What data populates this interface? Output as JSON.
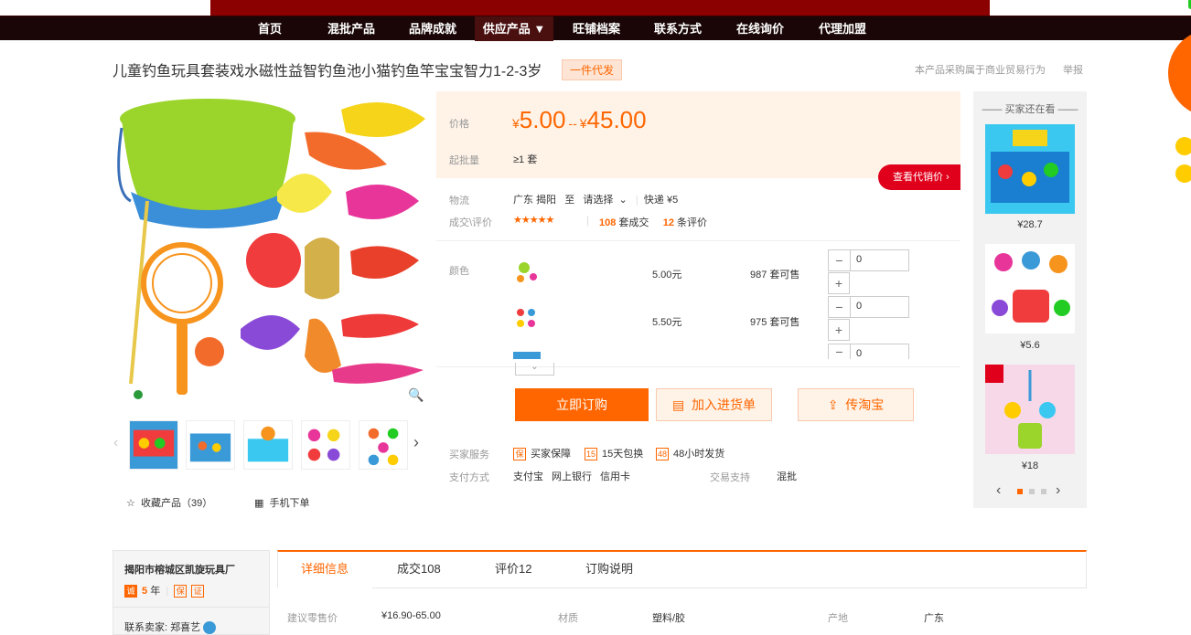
{
  "nav": {
    "items": [
      "首页",
      "混批产品",
      "品牌成就",
      "供应产品 ▼",
      "旺铺档案",
      "联系方式",
      "在线询价",
      "代理加盟"
    ]
  },
  "product": {
    "title": "儿童钓鱼玩具套装戏水磁性益智钓鱼池小猫钓鱼竿宝宝智力1-2-3岁",
    "tag": "一件代发",
    "note": "本产品采购属于商业贸易行为",
    "report": "举报"
  },
  "gallery": {
    "favorite": "收藏产品（39）",
    "mobile": "手机下单"
  },
  "price": {
    "label": "价格",
    "currency": "¥",
    "min": "5.00",
    "sep": "--",
    "max": "45.00",
    "batch_label": "起批量",
    "batch_value": "≥1 套",
    "agent_btn": "查看代销价 ›"
  },
  "logistics": {
    "label": "物流",
    "from": "广东 揭阳",
    "to": "至",
    "select": "请选择",
    "express": "快递 ¥5"
  },
  "reviews": {
    "label": "成交\\评价",
    "sold_count": "108",
    "sold_unit": "套成交",
    "review_count": "12",
    "review_unit": "条评价"
  },
  "sku": {
    "label": "颜色",
    "rows": [
      {
        "price": "5.00元",
        "stock": "987 套可售",
        "qty": "0"
      },
      {
        "price": "5.50元",
        "stock": "975 套可售",
        "qty": "0"
      },
      {
        "qty": "0"
      }
    ]
  },
  "actions": {
    "order": "立即订购",
    "cart": "加入进货单",
    "taobao": "传淘宝"
  },
  "service": {
    "label": "买家服务",
    "items": [
      {
        "icon": "保",
        "text": "买家保障"
      },
      {
        "icon": "15",
        "text": "15天包换"
      },
      {
        "icon": "48",
        "text": "48小时发货"
      }
    ],
    "pay_label": "支付方式",
    "pay_items": [
      "支付宝",
      "网上银行",
      "信用卡"
    ],
    "trade_label": "交易支持",
    "trade_value": "混批"
  },
  "sidebar": {
    "title": "买家还在看",
    "items": [
      {
        "price": "¥28.7"
      },
      {
        "price": "¥5.6"
      },
      {
        "price": "¥18"
      }
    ]
  },
  "shop": {
    "name": "揭阳市榕城区凯旋玩具厂",
    "years_num": "5",
    "years_unit": "年",
    "contact": "联系卖家: 郑喜艺"
  },
  "tabs": [
    "详细信息",
    "成交108",
    "评价12",
    "订购说明"
  ],
  "details": [
    {
      "k": "建议零售价",
      "v": "¥16.90-65.00"
    },
    {
      "k": "材质",
      "v": "塑料/胶"
    },
    {
      "k": "产地",
      "v": "广东"
    }
  ],
  "colors": {
    "accent": "#ff6600",
    "nav_bg": "#1a0606",
    "banner": "#8b0000",
    "red": "#e0001b"
  }
}
